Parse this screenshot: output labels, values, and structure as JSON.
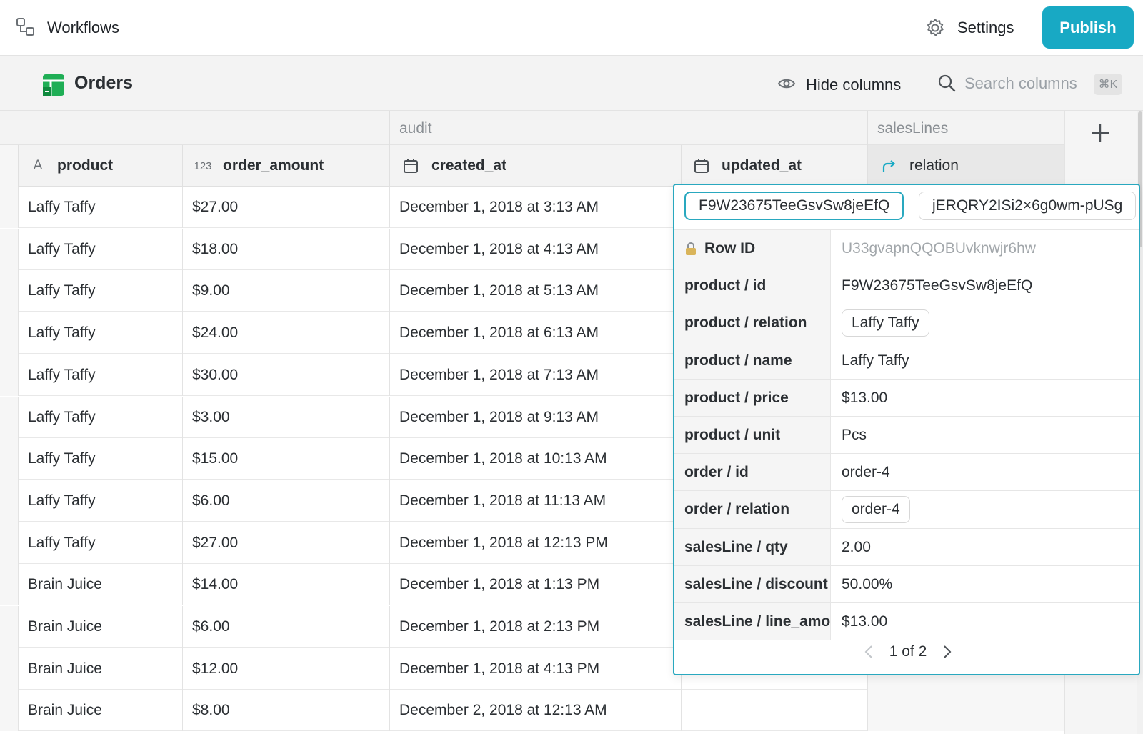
{
  "topbar": {
    "workflows_label": "Workflows",
    "settings_label": "Settings",
    "publish_label": "Publish"
  },
  "titlebar": {
    "title": "Orders",
    "hide_columns_label": "Hide columns",
    "search_placeholder": "Search columns",
    "search_shortcut": "⌘K"
  },
  "groups": {
    "audit": "audit",
    "saleslines": "salesLines"
  },
  "columns": {
    "product": "product",
    "product_type_icon": "A",
    "order_amount": "order_amount",
    "order_amount_type_icon": "123",
    "created_at": "created_at",
    "updated_at": "updated_at",
    "relation": "relation"
  },
  "rows": [
    {
      "product": "Laffy Taffy",
      "order_amount": "$27.00",
      "created_at": "December 1, 2018 at 3:13 AM"
    },
    {
      "product": "Laffy Taffy",
      "order_amount": "$18.00",
      "created_at": "December 1, 2018 at 4:13 AM"
    },
    {
      "product": "Laffy Taffy",
      "order_amount": "$9.00",
      "created_at": "December 1, 2018 at 5:13 AM"
    },
    {
      "product": "Laffy Taffy",
      "order_amount": "$24.00",
      "created_at": "December 1, 2018 at 6:13 AM"
    },
    {
      "product": "Laffy Taffy",
      "order_amount": "$30.00",
      "created_at": "December 1, 2018 at 7:13 AM"
    },
    {
      "product": "Laffy Taffy",
      "order_amount": "$3.00",
      "created_at": "December 1, 2018 at 9:13 AM"
    },
    {
      "product": "Laffy Taffy",
      "order_amount": "$15.00",
      "created_at": "December 1, 2018 at 10:13 AM"
    },
    {
      "product": "Laffy Taffy",
      "order_amount": "$6.00",
      "created_at": "December 1, 2018 at 11:13 AM"
    },
    {
      "product": "Laffy Taffy",
      "order_amount": "$27.00",
      "created_at": "December 1, 2018 at 12:13 PM"
    },
    {
      "product": "Brain Juice",
      "order_amount": "$14.00",
      "created_at": "December 1, 2018 at 1:13 PM"
    },
    {
      "product": "Brain Juice",
      "order_amount": "$6.00",
      "created_at": "December 1, 2018 at 2:13 PM"
    },
    {
      "product": "Brain Juice",
      "order_amount": "$12.00",
      "created_at": "December 1, 2018 at 4:13 PM"
    },
    {
      "product": "Brain Juice",
      "order_amount": "$8.00",
      "created_at": "December 2, 2018 at 12:13 AM"
    }
  ],
  "card": {
    "chips": [
      "F9W23675TeeGsvSw8jeEfQ",
      "jERQRY2ISi2×6g0wm-pUSg"
    ],
    "fields": [
      {
        "key": "Row ID",
        "value": "U33gvapnQQOBUvknwjr6hw",
        "locked": true,
        "pill": false
      },
      {
        "key": "product / id",
        "value": "F9W23675TeeGsvSw8jeEfQ",
        "pill": false
      },
      {
        "key": "product / relation",
        "value": "Laffy Taffy",
        "pill": true
      },
      {
        "key": "product / name",
        "value": "Laffy Taffy",
        "pill": false
      },
      {
        "key": "product / price",
        "value": "$13.00",
        "pill": false
      },
      {
        "key": "product / unit",
        "value": "Pcs",
        "pill": false
      },
      {
        "key": "order / id",
        "value": "order-4",
        "pill": false
      },
      {
        "key": "order / relation",
        "value": "order-4",
        "pill": true
      },
      {
        "key": "salesLine / qty",
        "value": "2.00",
        "pill": false
      },
      {
        "key": "salesLine / discount",
        "value": "50.00%",
        "pill": false
      },
      {
        "key": "salesLine / line_amo",
        "value": "$13.00",
        "pill": false
      }
    ],
    "pager": "1 of 2"
  },
  "colors": {
    "accent": "#18a9c4",
    "card_border": "#29a8bf",
    "sheet_icon": "#1fae55"
  }
}
